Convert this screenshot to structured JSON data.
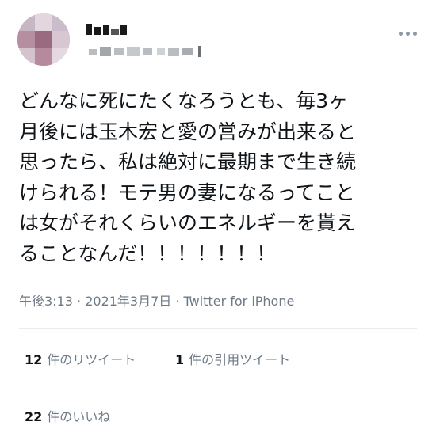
{
  "user": {
    "name": "▓▓▓",
    "handle": "▒▒▒▒▒▒▒▒▒"
  },
  "tweet": {
    "lines": [
      "どんなに死にたくなろうとも、毎3ヶ",
      "月後には玉木宏と愛の営みが出来ると",
      "思ったら、私は絶対に最期まで生き続",
      "けられる！モテ男の妻になるってこと",
      "は女がそれくらいのエネルギーを貰え",
      "ることなんだ！！！！！！！"
    ],
    "meta": "午後3:13 · 2021年3月7日 · Twitter for iPhone"
  },
  "stats": {
    "retweets": {
      "count": "12",
      "label": "件のリツイート"
    },
    "quotes": {
      "count": "1",
      "label": "件の引用ツイート"
    },
    "likes": {
      "count": "22",
      "label": "件のいいね"
    }
  },
  "icons": {
    "more": "more-horizontal-icon"
  },
  "colors": {
    "text": "#0f1419",
    "secondary": "#6e7a86",
    "divider": "#e6ecf0"
  }
}
